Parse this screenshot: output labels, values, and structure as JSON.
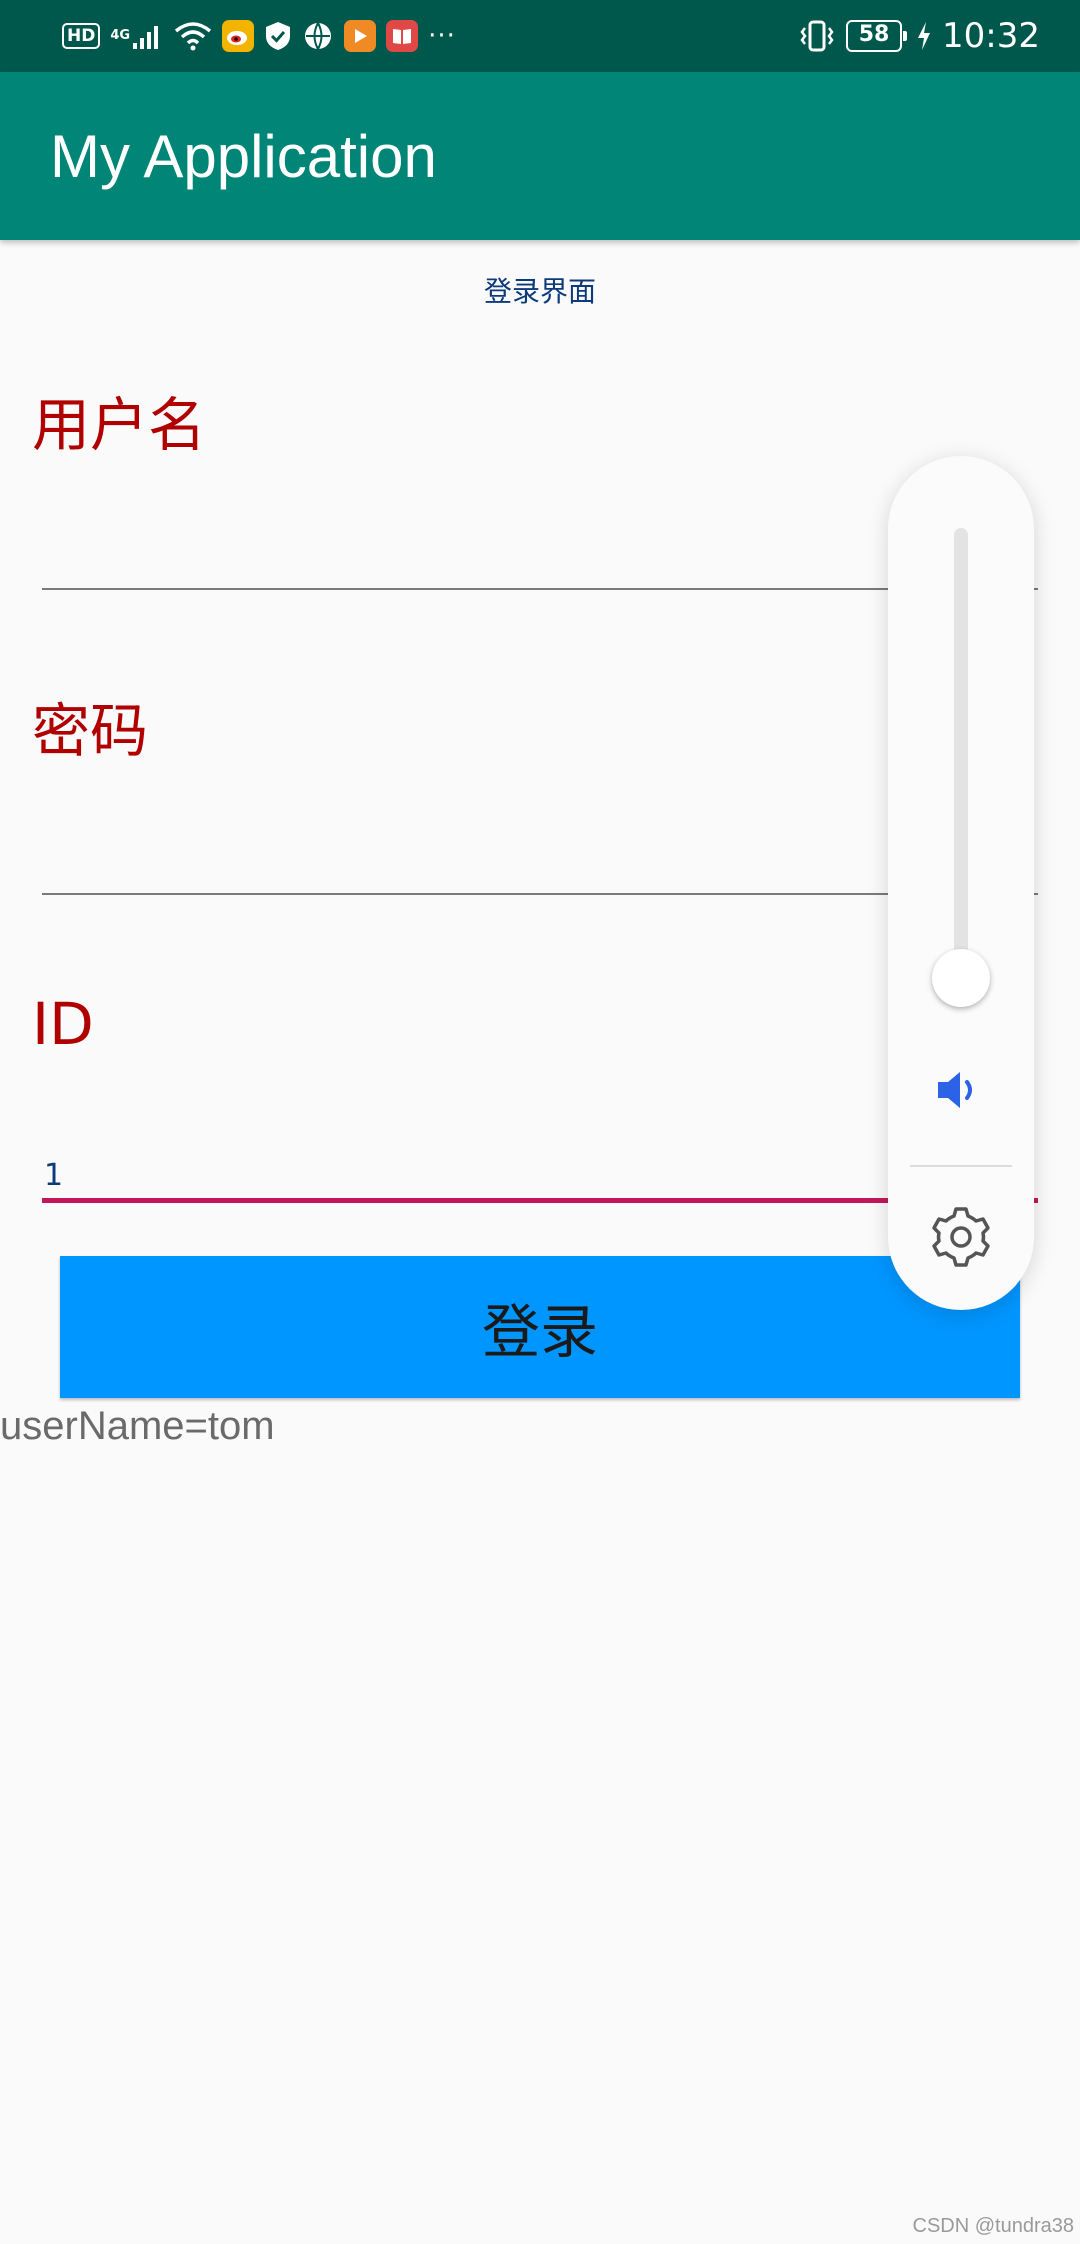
{
  "status_bar": {
    "left_icons": [
      "hd-icon",
      "signal-4g-icon",
      "wifi-icon",
      "weibo-icon",
      "shield-icon",
      "globe-icon",
      "video-app-icon",
      "book-app-icon",
      "more-icon"
    ],
    "hd_label": "HD",
    "network_label": "4G",
    "battery_level": "58",
    "time": "10:32",
    "right_icons": [
      "vibrate-icon",
      "battery-icon",
      "charging-icon"
    ]
  },
  "app_bar": {
    "title": "My Application"
  },
  "form": {
    "screen_title": "登录界面",
    "username": {
      "label": "用户名",
      "value": ""
    },
    "password": {
      "label": "密码",
      "value": ""
    },
    "id": {
      "label": "ID",
      "value": "1"
    },
    "login_button": "登录"
  },
  "result": "userName=tom",
  "volume_panel": {
    "level": 0.08,
    "icons": [
      "speaker-icon",
      "gear-icon"
    ],
    "accent_color": "#2c63e6"
  },
  "colors": {
    "status_bar": "#00574b",
    "app_bar": "#008577",
    "label": "#b00000",
    "button": "#0096ff",
    "input_focus": "#c2185b"
  },
  "watermark": "CSDN @tundra38"
}
